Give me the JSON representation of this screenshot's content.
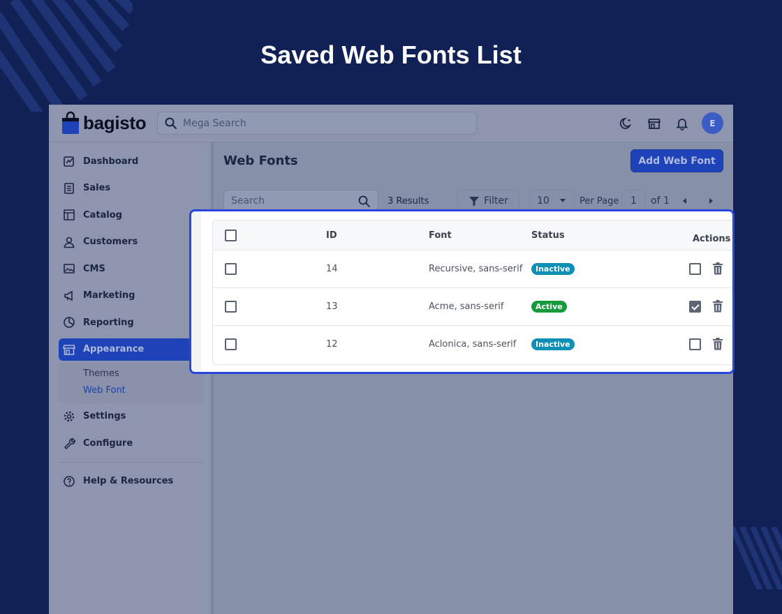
{
  "headline": "Saved Web Fonts List",
  "header": {
    "logo_text": "bagisto",
    "search_placeholder": "Mega Search",
    "avatar_initial": "E"
  },
  "sidebar": {
    "items": [
      {
        "label": "Dashboard",
        "icon": "dashboard-icon"
      },
      {
        "label": "Sales",
        "icon": "receipt-icon"
      },
      {
        "label": "Catalog",
        "icon": "catalog-icon"
      },
      {
        "label": "Customers",
        "icon": "user-icon"
      },
      {
        "label": "CMS",
        "icon": "image-icon"
      },
      {
        "label": "Marketing",
        "icon": "megaphone-icon"
      },
      {
        "label": "Reporting",
        "icon": "pie-chart-icon"
      },
      {
        "label": "Appearance",
        "icon": "store-icon"
      },
      {
        "label": "Settings",
        "icon": "gear-icon"
      },
      {
        "label": "Configure",
        "icon": "wrench-icon"
      },
      {
        "label": "Help & Resources",
        "icon": "help-icon"
      }
    ],
    "submenu": [
      "Themes",
      "Web Font"
    ]
  },
  "main": {
    "title": "Web Fonts",
    "add_button": "Add Web Font",
    "search_placeholder": "Search",
    "results": "3 Results",
    "filter_label": "Filter",
    "per_page_value": "10",
    "per_page_label": "Per Page",
    "page_current": "1",
    "page_total": "of 1"
  },
  "table": {
    "headers": {
      "id": "ID",
      "font": "Font",
      "status": "Status",
      "actions": "Actions"
    },
    "rows": [
      {
        "id": "14",
        "font": "Recursive, sans-serif",
        "status": "Inactive",
        "active": false
      },
      {
        "id": "13",
        "font": "Acme, sans-serif",
        "status": "Active",
        "active": true
      },
      {
        "id": "12",
        "font": "Aclonica, sans-serif",
        "status": "Inactive",
        "active": false
      }
    ]
  },
  "colors": {
    "background": "#112155",
    "primary": "#1e43b8",
    "highlight_border": "#2547e0",
    "inactive_badge": "#0d8fb6",
    "active_badge": "#179a3c"
  }
}
